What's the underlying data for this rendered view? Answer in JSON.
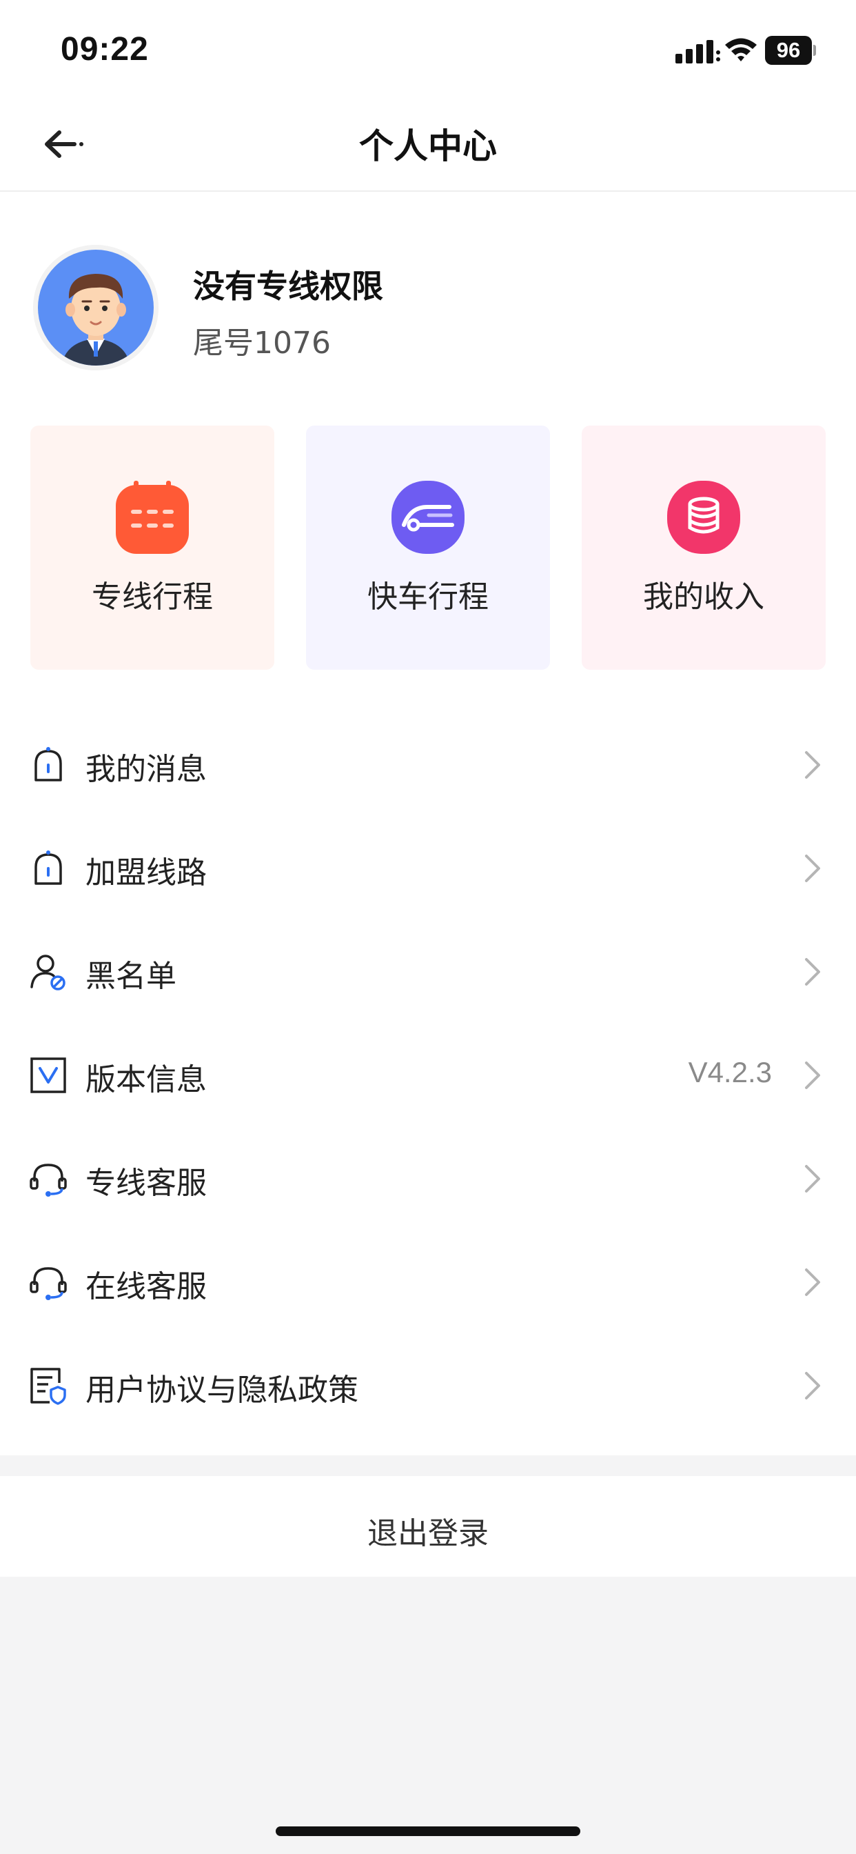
{
  "status_bar": {
    "time": "09:22",
    "battery": "96"
  },
  "nav": {
    "title": "个人中心",
    "back_icon": "back-arrow-icon"
  },
  "profile": {
    "name": "没有专线权限",
    "phone_tail": "尾号1076",
    "avatar_icon": "avatar-man-icon"
  },
  "cards": [
    {
      "label": "专线行程",
      "icon": "calendar-icon",
      "color": "#ff5a36",
      "bg": "#fff4f1"
    },
    {
      "label": "快车行程",
      "icon": "car-icon",
      "color": "#6e5cf2",
      "bg": "#f5f4ff"
    },
    {
      "label": "我的收入",
      "icon": "coins-icon",
      "color": "#f2366a",
      "bg": "#fff2f5"
    }
  ],
  "menu": [
    {
      "label": "我的消息",
      "icon": "bell-icon",
      "value": ""
    },
    {
      "label": "加盟线路",
      "icon": "bell-icon",
      "value": ""
    },
    {
      "label": "黑名单",
      "icon": "user-block-icon",
      "value": ""
    },
    {
      "label": "版本信息",
      "icon": "version-icon",
      "value": "V4.2.3"
    },
    {
      "label": "专线客服",
      "icon": "headset-icon",
      "value": ""
    },
    {
      "label": "在线客服",
      "icon": "headset-icon",
      "value": ""
    },
    {
      "label": "用户协议与隐私政策",
      "icon": "document-shield-icon",
      "value": ""
    }
  ],
  "logout": {
    "label": "退出登录"
  },
  "colors": {
    "accent_blue": "#2b6ff2",
    "page_bg": "#f4f4f5"
  }
}
